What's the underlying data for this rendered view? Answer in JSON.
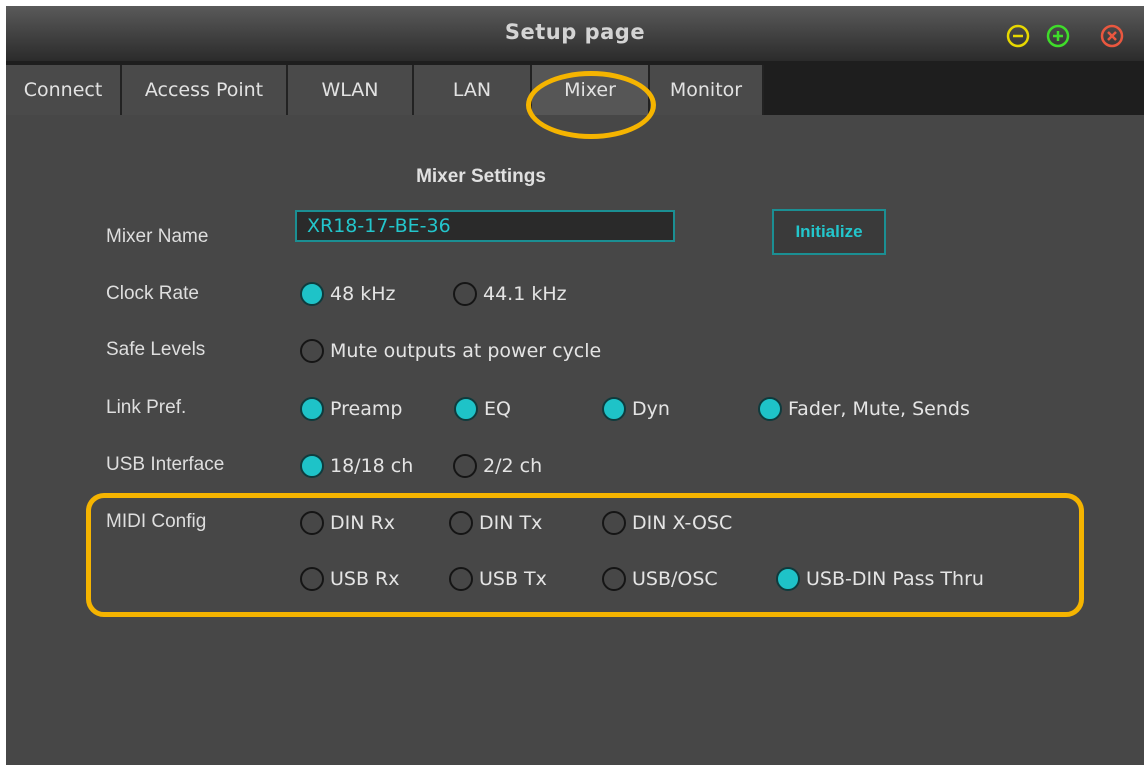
{
  "window": {
    "title": "Setup page"
  },
  "tabs": [
    {
      "label": "Connect"
    },
    {
      "label": "Access Point"
    },
    {
      "label": "WLAN"
    },
    {
      "label": "LAN"
    },
    {
      "label": "Mixer"
    },
    {
      "label": "Monitor"
    }
  ],
  "active_tab": "Mixer",
  "heading": "Mixer Settings",
  "mixer_name": {
    "label": "Mixer Name",
    "value": "XR18-17-BE-36"
  },
  "initialize_label": "Initialize",
  "clock_rate": {
    "label": "Clock Rate",
    "options": [
      "48 kHz",
      "44.1 kHz"
    ],
    "selected": "48 kHz"
  },
  "safe_levels": {
    "label": "Safe Levels",
    "option": "Mute outputs at power cycle",
    "checked": false
  },
  "link_pref": {
    "label": "Link Pref.",
    "options": [
      "Preamp",
      "EQ",
      "Dyn",
      "Fader, Mute, Sends"
    ],
    "checked": [
      true,
      true,
      true,
      true
    ]
  },
  "usb_interface": {
    "label": "USB Interface",
    "options": [
      "18/18 ch",
      "2/2 ch"
    ],
    "selected": "18/18 ch"
  },
  "midi_config": {
    "label": "MIDI Config",
    "row1": [
      "DIN Rx",
      "DIN Tx",
      "DIN X-OSC"
    ],
    "row2": [
      "USB Rx",
      "USB Tx",
      "USB/OSC",
      "USB-DIN Pass Thru"
    ],
    "selected": "USB-DIN Pass Thru"
  },
  "colors": {
    "accent": "#1ec3c8",
    "highlight": "#f5b400",
    "panel": "#474747"
  },
  "icons": {
    "minimize": "minus-circle-icon",
    "maximize": "plus-circle-icon",
    "close": "x-circle-icon"
  }
}
